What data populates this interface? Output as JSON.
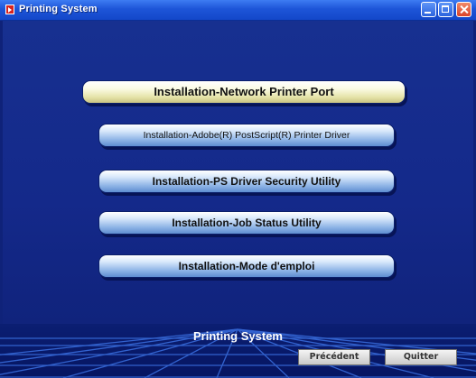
{
  "window": {
    "title": "Printing System",
    "icons": {
      "app": "app-icon",
      "minimize": "minimize-icon",
      "maximize": "maximize-icon",
      "close": "close-icon"
    }
  },
  "menu": {
    "items": [
      {
        "label": "Installation-Network Printer Port",
        "selected": true
      },
      {
        "label": "Installation-Adobe(R) PostScript(R) Printer Driver",
        "selected": false
      },
      {
        "label": "Installation-PS Driver Security Utility",
        "selected": false
      },
      {
        "label": "Installation-Job Status Utility",
        "selected": false
      },
      {
        "label": "Installation-Mode d'emploi",
        "selected": false
      }
    ]
  },
  "footer": {
    "title": "Printing System",
    "previous_label": "Précédent",
    "quit_label": "Quitter"
  },
  "colors": {
    "titlebar": "#1d55d8",
    "background": "#14298a",
    "button_selected": "#e4e2a6",
    "button": "#8fb5e6",
    "grid_lines": "#3a6fe0"
  }
}
